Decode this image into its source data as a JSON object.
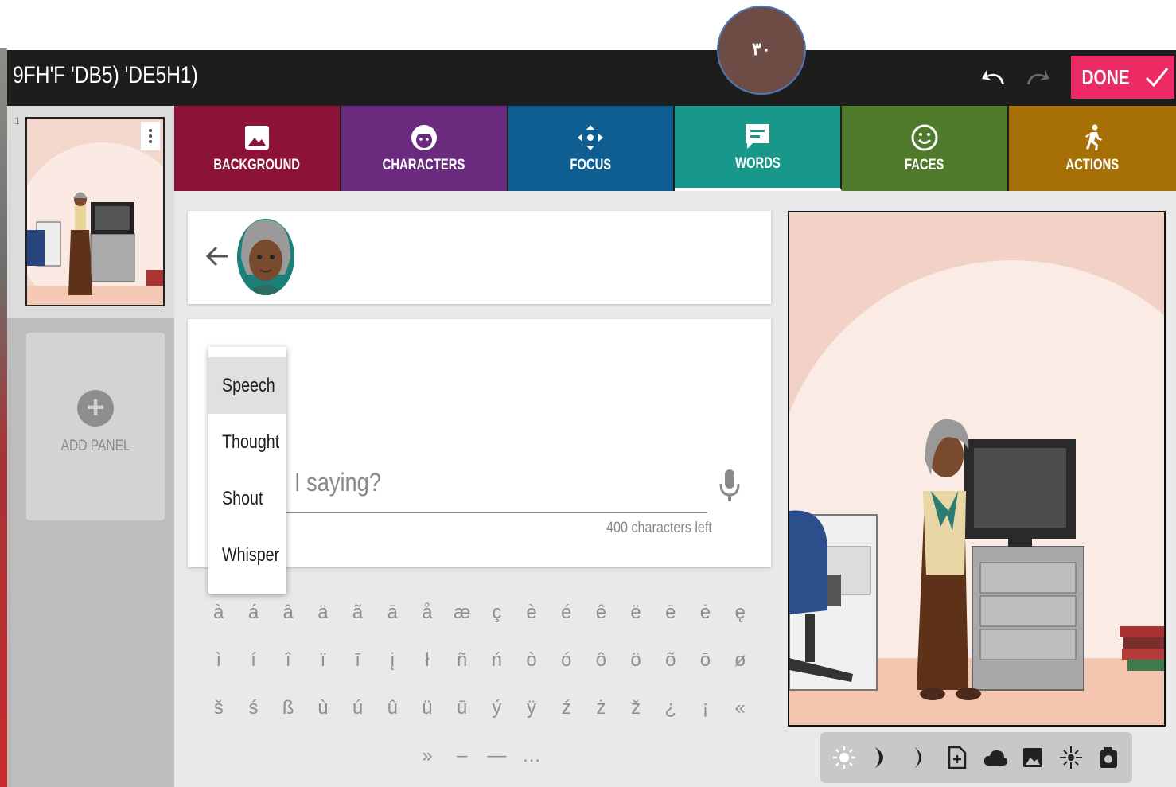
{
  "header": {
    "title": "9FH'F 'DB5) 'DE5H1)",
    "badge": "٣٠",
    "done_label": "DONE"
  },
  "sidebar": {
    "panel_number": "1",
    "add_panel_label": "ADD PANEL"
  },
  "tabs": [
    {
      "label": "BACKGROUND",
      "color": "#8c1237",
      "icon": "image-icon"
    },
    {
      "label": "CHARACTERS",
      "color": "#6a2b7e",
      "icon": "character-face-icon"
    },
    {
      "label": "FOCUS",
      "color": "#0f5e92",
      "icon": "focus-arrows-icon"
    },
    {
      "label": "WORDS",
      "color": "#17988a",
      "icon": "speech-bubble-icon"
    },
    {
      "label": "FACES",
      "color": "#4f7a2b",
      "icon": "smiley-icon"
    },
    {
      "label": "ACTIONS",
      "color": "#a77006",
      "icon": "running-person-icon"
    }
  ],
  "words": {
    "text_placeholder": "t am I saying?",
    "text_placeholder_visible": "I saying?",
    "chars_left": "400 characters left",
    "bubble_types": [
      "Speech",
      "Thought",
      "Shout",
      "Whisper"
    ],
    "selected_bubble": "Speech"
  },
  "special_chars": [
    [
      "à",
      "á",
      "â",
      "ä",
      "ã",
      "ā",
      "å",
      "æ",
      "ç",
      "è",
      "é",
      "ê",
      "ë",
      "ē",
      "ė",
      "ę"
    ],
    [
      "ì",
      "í",
      "î",
      "ï",
      "ī",
      "į",
      "ł",
      "ñ",
      "ń",
      "ò",
      "ó",
      "ô",
      "ö",
      "õ",
      "ō",
      "ø"
    ],
    [
      "š",
      "ś",
      "ß",
      "ù",
      "ú",
      "û",
      "ü",
      "ū",
      "ý",
      "ÿ",
      "ź",
      "ż",
      "ž",
      "¿",
      "¡",
      "«"
    ],
    [
      "»",
      "–",
      "—",
      "…"
    ]
  ],
  "colors": {
    "accent": "#ec2a63",
    "topbar": "#1d1d1d",
    "badge": "#6d4c45"
  },
  "toolbar_icons": [
    "brightness-icon",
    "moon-icon",
    "crescent-icon",
    "add-page-icon",
    "cloud-icon",
    "image-icon",
    "sparkle-icon",
    "camera-icon"
  ]
}
